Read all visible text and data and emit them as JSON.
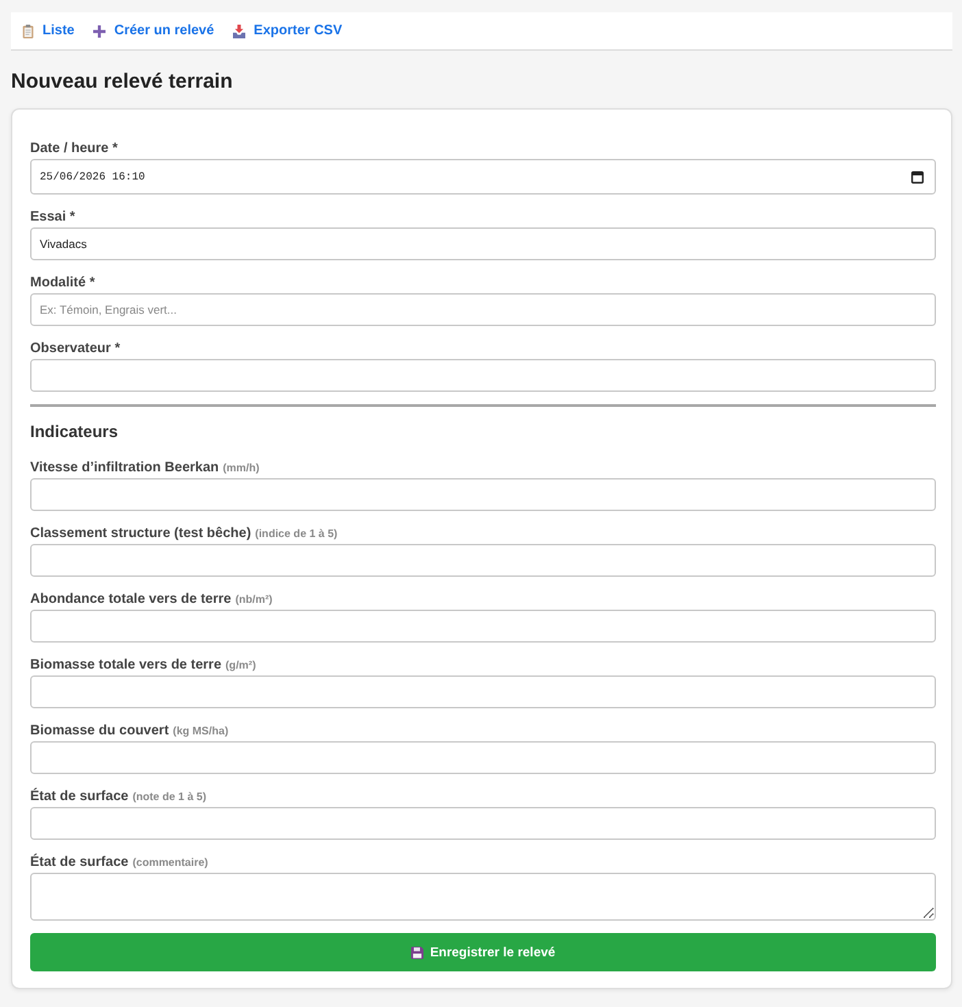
{
  "nav": {
    "links": [
      {
        "kind": "list",
        "label": "Liste"
      },
      {
        "kind": "create",
        "label": "Créer un relevé"
      },
      {
        "kind": "export",
        "label": "Exporter CSV"
      }
    ]
  },
  "title": "Nouveau relevé terrain",
  "form": {
    "fields": [
      {
        "kind": "datetime",
        "label": "Date / heure *",
        "value": "25/06/2026 16:10"
      },
      {
        "kind": "text",
        "label": "Essai *",
        "value": "Vivadacs"
      },
      {
        "kind": "text",
        "label": "Modalité *",
        "placeholder": "Ex: Témoin, Engrais vert..."
      },
      {
        "kind": "text",
        "label": "Observateur *"
      }
    ],
    "section": {
      "heading": "Indicateurs",
      "fields": [
        {
          "kind": "text",
          "label": "Vitesse d’infiltration Beerkan",
          "hint": "(mm/h)"
        },
        {
          "kind": "text",
          "label": "Classement structure (test bêche)",
          "hint": "(indice de 1 à 5)"
        },
        {
          "kind": "text",
          "label": "Abondance totale vers de terre",
          "hint": "(nb/m²)"
        },
        {
          "kind": "text",
          "label": "Biomasse totale vers de terre",
          "hint": "(g/m²)"
        },
        {
          "kind": "text",
          "label": "Biomasse du couvert",
          "hint": "(kg MS/ha)"
        },
        {
          "kind": "text",
          "label": "État de surface",
          "hint": "(note de 1 à 5)"
        },
        {
          "kind": "textarea",
          "label": "État de surface",
          "hint": "(commentaire)"
        }
      ]
    },
    "submit": {
      "label": "Enregistrer le relevé"
    }
  }
}
